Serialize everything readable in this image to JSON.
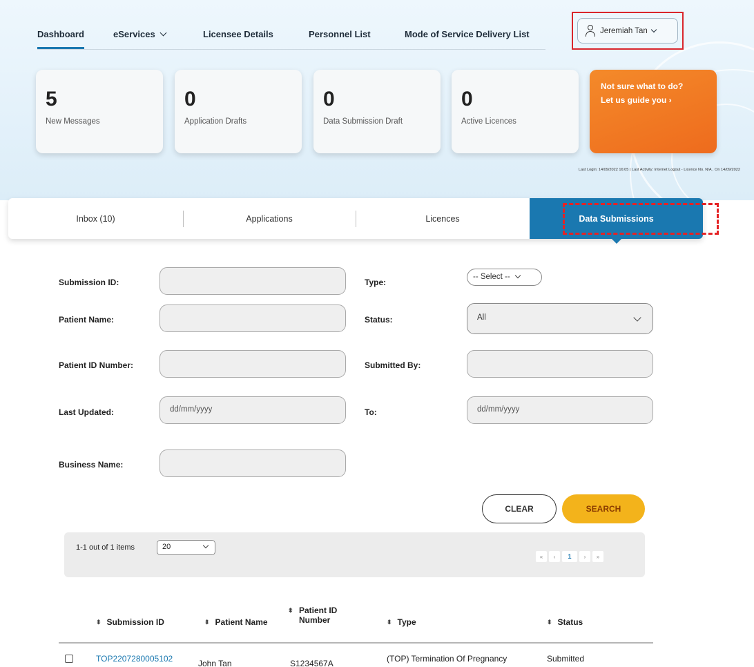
{
  "nav": {
    "items": [
      {
        "label": "Dashboard",
        "active": true
      },
      {
        "label": "eServices",
        "dropdown": true
      },
      {
        "label": "Licensee Details"
      },
      {
        "label": "Personnel List"
      },
      {
        "label": "Mode of Service Delivery List"
      }
    ],
    "user_name": "Jeremiah Tan"
  },
  "cards": [
    {
      "value": "5",
      "label": "New Messages"
    },
    {
      "value": "0",
      "label": "Application Drafts"
    },
    {
      "value": "0",
      "label": "Data Submission Draft"
    },
    {
      "value": "0",
      "label": "Active Licences"
    }
  ],
  "cta": {
    "line1": "Not sure what to do?",
    "line2": "Let us guide you ›"
  },
  "last_login": "Last Login: 14/09/2022 16:05 | Last Activity: Internet Logout - Licence No. N/A , On 14/09/2022",
  "tabs": [
    {
      "label": "Inbox (10)"
    },
    {
      "label": "Applications"
    },
    {
      "label": "Licences"
    },
    {
      "label": "Data Submissions",
      "active": true
    }
  ],
  "form": {
    "submission_id_label": "Submission ID:",
    "patient_name_label": "Patient Name:",
    "patient_id_label": "Patient ID Number:",
    "last_updated_label": "Last Updated:",
    "last_updated_placeholder": "dd/mm/yyyy",
    "business_name_label": "Business Name:",
    "type_label": "Type:",
    "type_value": "-- Select --",
    "status_label": "Status:",
    "status_value": "All",
    "submitted_by_label": "Submitted By:",
    "to_label": "To:",
    "to_placeholder": "dd/mm/yyyy",
    "clear_label": "CLEAR",
    "search_label": "SEARCH"
  },
  "pager": {
    "count_text": "1-1 out of 1 items",
    "page_size": "20",
    "first": "«",
    "prev": "‹",
    "current": "1",
    "next": "›",
    "last": "»"
  },
  "table": {
    "sort_icon": "⬍",
    "headers": {
      "submission_id": "Submission ID",
      "patient_name": "Patient Name",
      "patient_id_line1": "Patient ID",
      "patient_id_line2": "Number",
      "type": "Type",
      "status": "Status"
    },
    "rows": [
      {
        "submission_id": "TOP2207280005102",
        "patient_name": "John Tan",
        "patient_id": "S1234567A",
        "type": "(TOP) Termination Of Pregnancy",
        "status": "Submitted"
      }
    ]
  },
  "colors": {
    "accent": "#1a78b0",
    "cta": "#ee6b1d",
    "search_button": "#f3b31b",
    "highlight": "#d9262c"
  }
}
